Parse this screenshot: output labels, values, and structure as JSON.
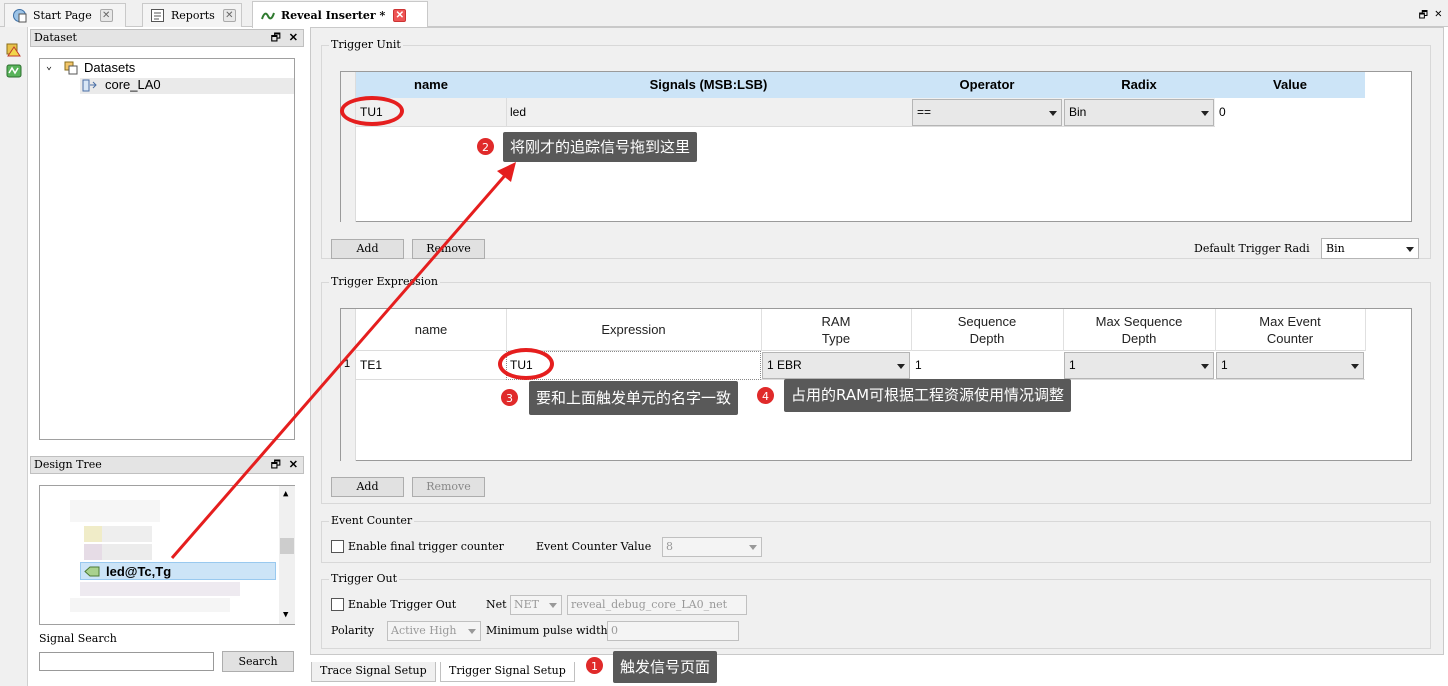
{
  "tabs": [
    {
      "label": "Start Page",
      "icon": "globe-page-icon"
    },
    {
      "label": "Reports",
      "icon": "report-icon"
    },
    {
      "label": "Reveal Inserter *",
      "icon": "inserter-icon"
    }
  ],
  "dataset_panel": {
    "title": "Dataset",
    "tree_root": "Datasets",
    "tree_child": "core_LA0"
  },
  "design_tree_panel": {
    "title": "Design Tree",
    "selected_item": "led@Tc,Tg",
    "signal_search_label": "Signal Search",
    "search_button": "Search",
    "search_value": ""
  },
  "trigger_unit": {
    "title": "Trigger Unit",
    "columns": [
      "name",
      "Signals (MSB:LSB)",
      "Operator",
      "Radix",
      "Value"
    ],
    "rows": [
      {
        "name": "TU1",
        "signals": "led",
        "operator": "==",
        "radix": "Bin",
        "value": "0"
      }
    ],
    "add_button": "Add",
    "remove_button": "Remove",
    "default_radix_label": "Default Trigger Radi",
    "default_radix_value": "Bin"
  },
  "trigger_expression": {
    "title": "Trigger Expression",
    "columns": {
      "name": "name",
      "expression": "Expression",
      "ram_l1": "RAM",
      "ram_l2": "Type",
      "seq_l1": "Sequence",
      "seq_l2": "Depth",
      "maxseq_l1": "Max Sequence",
      "maxseq_l2": "Depth",
      "maxevt_l1": "Max Event",
      "maxevt_l2": "Counter"
    },
    "rows": [
      {
        "index": "1",
        "name": "TE1",
        "expression": "TU1",
        "ram_type": "1 EBR",
        "sequence_depth": "1",
        "max_sequence_depth": "1",
        "max_event_counter": "1"
      }
    ],
    "add_button": "Add",
    "remove_button": "Remove"
  },
  "event_counter": {
    "title": "Event Counter",
    "enable_label": "Enable final trigger counter",
    "value_label": "Event Counter Value",
    "value": "8"
  },
  "trigger_out": {
    "title": "Trigger Out",
    "enable_label": "Enable Trigger Out",
    "net_label": "Net",
    "net_type": "NET",
    "net_value": "reveal_debug_core_LA0_net",
    "polarity_label": "Polarity",
    "polarity_value": "Active High",
    "min_pulse_label": "Minimum pulse width",
    "min_pulse_value": "0"
  },
  "bottom_tabs": [
    "Trace Signal Setup",
    "Trigger Signal Setup"
  ],
  "annotations": [
    {
      "num": "1",
      "text": "触发信号页面"
    },
    {
      "num": "2",
      "text": "将刚才的追踪信号拖到这里"
    },
    {
      "num": "3",
      "text": "要和上面触发单元的名字一致"
    },
    {
      "num": "4",
      "text": "占用的RAM可根据工程资源使用情况调整"
    }
  ],
  "colors": {
    "header_blue": "#cce4f7",
    "annotation_red": "#e51e1e",
    "note_bg": "#595959"
  }
}
